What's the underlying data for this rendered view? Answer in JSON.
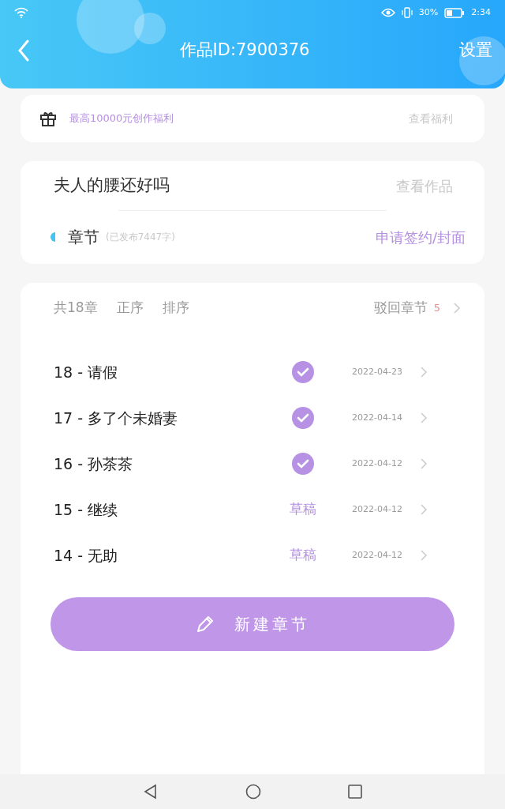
{
  "status_bar": {
    "battery_percent": "30%",
    "time": "2:34"
  },
  "header": {
    "title": "作品ID:7900376",
    "action": "设置"
  },
  "benefit": {
    "text": "最高10000元创作福利",
    "link": "查看福利"
  },
  "work": {
    "name": "夫人的腰还好吗",
    "link": "查看作品",
    "section": "章节",
    "section_note": "(已发布7447字)",
    "apply": "申请签约/封面"
  },
  "chapters_bar": {
    "total": "共18章",
    "order": "正序",
    "sort": "排序",
    "rejected": "驳回章节",
    "rejected_count": "5"
  },
  "chapters": [
    {
      "title": "18 - 请假",
      "kind": "published",
      "date": "2022-04-23"
    },
    {
      "title": "17 - 多了个未婚妻",
      "kind": "published",
      "date": "2022-04-14"
    },
    {
      "title": "16 - 孙茶茶",
      "kind": "published",
      "date": "2022-04-12"
    },
    {
      "title": "15 - 继续",
      "kind": "draft",
      "status": "草稿",
      "date": "2022-04-12"
    },
    {
      "title": "14 - 无助",
      "kind": "draft",
      "status": "草稿",
      "date": "2022-04-12"
    }
  ],
  "new_chapter_button": "新建章节"
}
